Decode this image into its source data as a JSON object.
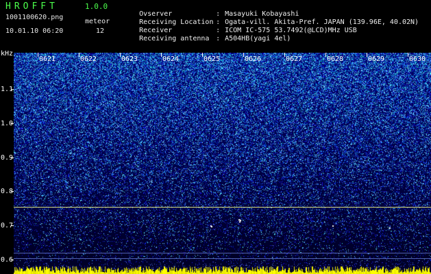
{
  "header": {
    "logo": "HROFFT",
    "version": "1.0.0",
    "filename": "1001100620.png",
    "timestamp": "10.01.10 06:20",
    "meteor_label": "meteor",
    "meteor_count": "12"
  },
  "info": [
    {
      "label": "Ovserver",
      "value": "Masayuki Kobayashi"
    },
    {
      "label": "Receiving Location",
      "value": "Ogata-vill. Akita-Pref. JAPAN (139.96E, 40.02N)"
    },
    {
      "label": "Receiver",
      "value": "ICOM IC-575 53.7492(@LCD)MHz USB"
    },
    {
      "label": "Receiving antenna",
      "value": "A504HB(yagi 4el)"
    }
  ],
  "spectrogram": {
    "y_unit": "kHz",
    "y_ticks": [
      "1.1",
      "1.0",
      "0.9",
      "0.8",
      "0.7",
      "0.6"
    ],
    "x_ticks": [
      "0621",
      "0622",
      "0623",
      "0624",
      "0625",
      "0626",
      "0627",
      "0628",
      "0629",
      "0630"
    ],
    "colors": {
      "background_dark": "#000040",
      "noise_high": "#6aa8ff",
      "carrier_line": "#d8e080",
      "baseline_strip": "#ffff00"
    }
  }
}
